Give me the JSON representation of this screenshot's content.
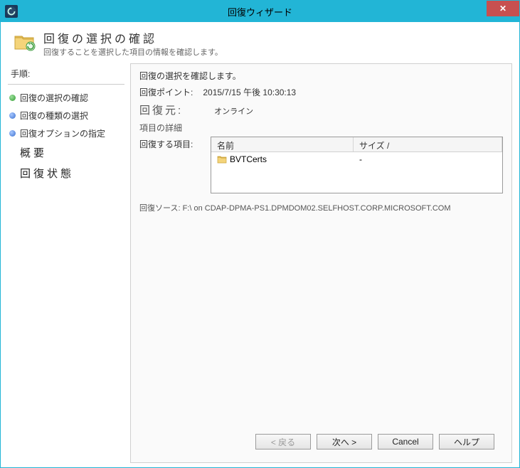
{
  "window": {
    "title": "回復ウィザード"
  },
  "header": {
    "title": "回復の選択の確認",
    "subtitle": "回復することを選択した項目の情報を確認します。"
  },
  "sidebar": {
    "title": "手順:",
    "steps": [
      {
        "label": "回復の選択の確認",
        "state": "current"
      },
      {
        "label": "回復の種類の選択",
        "state": "done"
      },
      {
        "label": "回復オプションの指定",
        "state": "done"
      },
      {
        "label": "概要",
        "state": "pending"
      },
      {
        "label": "回復状態",
        "state": "pending"
      }
    ]
  },
  "main": {
    "line1": "回復の選択を確認します。",
    "recovery_point_label": "回復ポイント:",
    "recovery_point_value": "2015/7/15 午後 10:30:13",
    "origin_label": "回復元:",
    "origin_value": "オンライン",
    "detail_label": "項目の詳細",
    "items_label": "回復する項目:",
    "table": {
      "col_name": "名前",
      "col_size": "サイズ /",
      "rows": [
        {
          "name": "BVTCerts",
          "size": "-"
        }
      ]
    },
    "source_label": "回復ソース:",
    "source_value": "F:\\ on CDAP-DPMA-PS1.DPMDOM02.SELFHOST.CORP.MICROSOFT.COM"
  },
  "buttons": {
    "back": "< 戻る",
    "next": "次へ >",
    "cancel": "Cancel",
    "help": "ヘルプ"
  }
}
